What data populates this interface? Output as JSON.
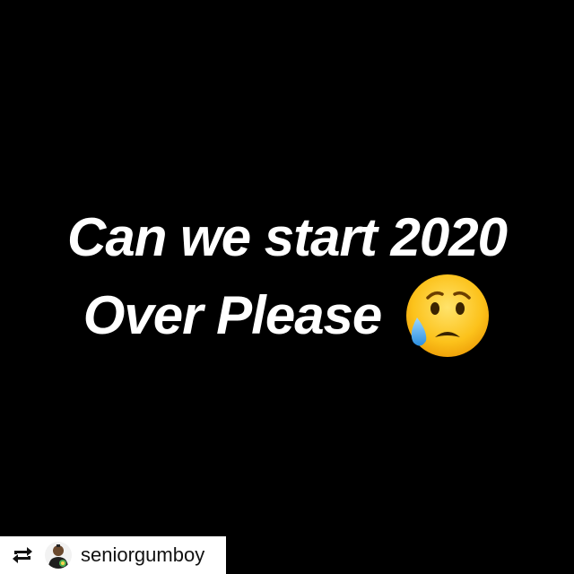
{
  "post": {
    "line1": "Can we start 2020",
    "line2": "Over Please",
    "emoji_icon": "sad-but-relieved-face-icon",
    "background_color": "#000000",
    "text_color": "#ffffff"
  },
  "repost": {
    "icon": "repost-icon",
    "avatar": "avatar",
    "username": "seniorgumboy"
  }
}
